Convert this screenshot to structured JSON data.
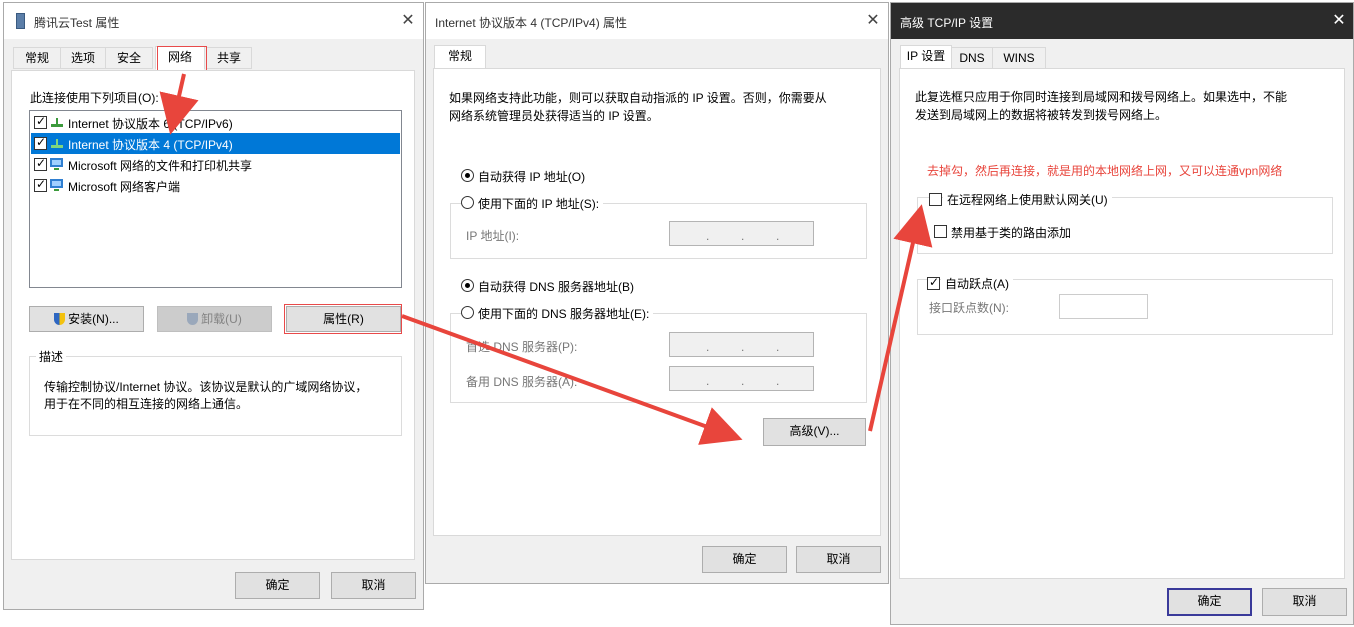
{
  "dialog1": {
    "title": "腾讯云Test 属性",
    "tabs": [
      "常规",
      "选项",
      "安全",
      "网络",
      "共享"
    ],
    "connection_label": "此连接使用下列项目(O):",
    "items": [
      {
        "label": "Internet 协议版本 6 (TCP/IPv6)",
        "checked": true,
        "icon": "network-protocol-icon"
      },
      {
        "label": "Internet 协议版本 4 (TCP/IPv4)",
        "checked": true,
        "icon": "network-protocol-icon",
        "selected": true
      },
      {
        "label": "Microsoft 网络的文件和打印机共享",
        "checked": true,
        "icon": "network-computer-icon"
      },
      {
        "label": "Microsoft 网络客户端",
        "checked": true,
        "icon": "network-computer-icon"
      }
    ],
    "install_label": "安装(N)...",
    "uninstall_label": "卸载(U)",
    "properties_label": "属性(R)",
    "description_title": "描述",
    "description_line1": "传输控制协议/Internet 协议。该协议是默认的广域网络协议，",
    "description_line2": "用于在不同的相互连接的网络上通信。",
    "ok_label": "确定",
    "cancel_label": "取消"
  },
  "dialog2": {
    "title": "Internet 协议版本 4 (TCP/IPv4) 属性",
    "tab": "常规",
    "intro_line1": "如果网络支持此功能，则可以获取自动指派的 IP 设置。否则，你需要从",
    "intro_line2": "网络系统管理员处获得适当的 IP 设置。",
    "auto_ip_label": "自动获得 IP 地址(O)",
    "manual_ip_label": "使用下面的 IP 地址(S):",
    "ip_address_label": "IP 地址(I):",
    "auto_dns_label": "自动获得 DNS 服务器地址(B)",
    "manual_dns_label": "使用下面的 DNS 服务器地址(E):",
    "preferred_dns_label": "首选 DNS 服务器(P):",
    "alternate_dns_label": "备用 DNS 服务器(A):",
    "advanced_label": "高级(V)...",
    "ok_label": "确定",
    "cancel_label": "取消"
  },
  "dialog3": {
    "title": "高级 TCP/IP 设置",
    "tabs": [
      "IP 设置",
      "DNS",
      "WINS"
    ],
    "info_line1": "此复选框只应用于你同时连接到局域网和拨号网络上。如果选中，不能",
    "info_line2": "发送到局域网上的数据将被转发到拨号网络上。",
    "annotation": "去掉勾，然后再连接，就是用的本地网络上网，又可以连通vpn网络",
    "default_gateway_label": "在远程网络上使用默认网关(U)",
    "disable_class_route_label": "禁用基于类的路由添加",
    "auto_metric_label": "自动跃点(A)",
    "interface_metric_label": "接口跃点数(N):",
    "ok_label": "确定",
    "cancel_label": "取消"
  },
  "colors": {
    "annotation_red": "#e8453c",
    "selection_blue": "#0078d7",
    "dialog_bg": "#f0f0f0"
  }
}
